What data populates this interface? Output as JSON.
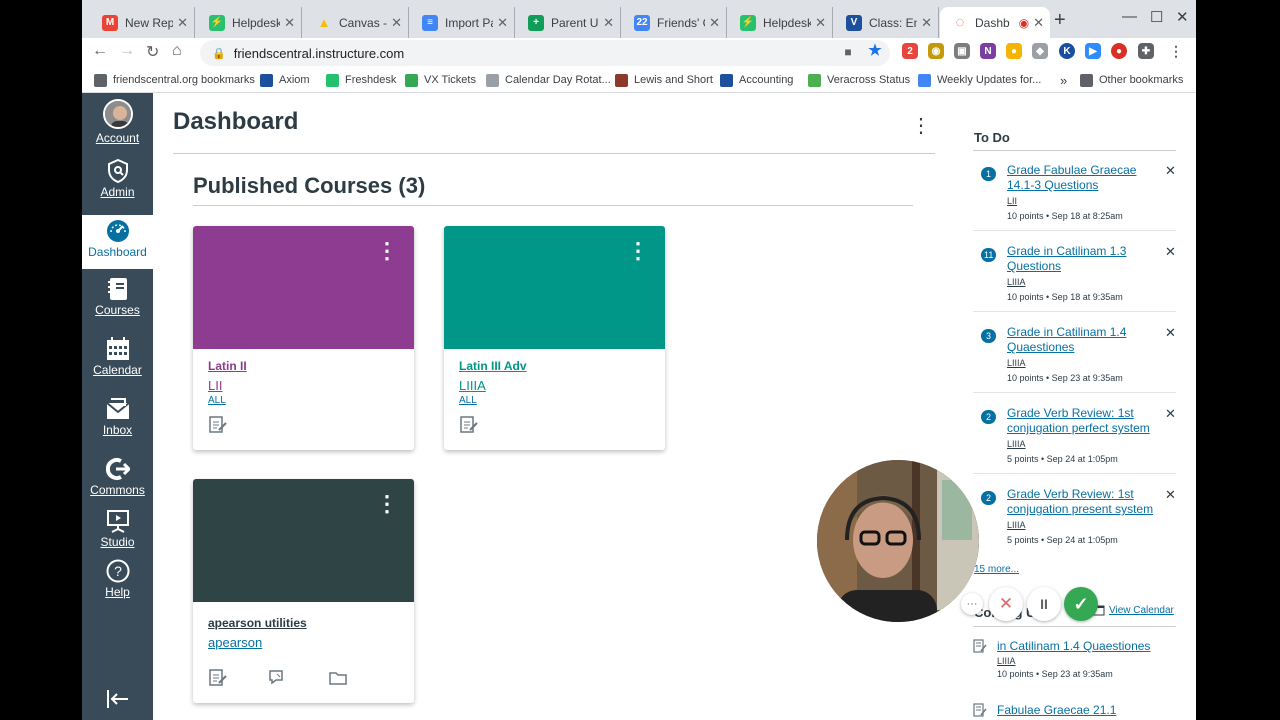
{
  "browser": {
    "tabs": [
      {
        "title": "New Reply",
        "icon": "gmail-icon",
        "color": "#ea4335",
        "glyph": "M"
      },
      {
        "title": "Helpdesk :",
        "icon": "freshdesk-icon",
        "color": "#25c16f",
        "glyph": "⚡"
      },
      {
        "title": "Canvas - G",
        "icon": "google-drive-icon",
        "color": "#fbbc04",
        "glyph": "▲"
      },
      {
        "title": "Import Par",
        "icon": "google-docs-icon",
        "color": "#4285f4",
        "glyph": "≡"
      },
      {
        "title": "Parent Use",
        "icon": "google-sheets-icon",
        "color": "#0f9d58",
        "glyph": "+"
      },
      {
        "title": "Friends' Ce",
        "icon": "google-calendar-icon",
        "color": "#4285f4",
        "glyph": "22"
      },
      {
        "title": "Helpdesk :",
        "icon": "freshdesk-icon",
        "color": "#25c16f",
        "glyph": "⚡"
      },
      {
        "title": "Class: Engl",
        "icon": "veracross-icon",
        "color": "#1c4f9c",
        "glyph": "V"
      },
      {
        "title": "Dashb",
        "icon": "canvas-icon",
        "color": "#e4572e",
        "glyph": "◌"
      }
    ],
    "url": "friendscentral.instructure.com",
    "bookmarks": [
      {
        "label": "friendscentral.org bookmarks",
        "icon": "folder-icon",
        "color": "#5f6368"
      },
      {
        "label": "Axiom",
        "icon": "veracross-icon",
        "color": "#1c4f9c"
      },
      {
        "label": "Freshdesk",
        "icon": "freshdesk-icon",
        "color": "#25c16f"
      },
      {
        "label": "VX Tickets",
        "icon": "vx-icon",
        "color": "#34a853"
      },
      {
        "label": "Calendar Day Rotat...",
        "icon": "globe-icon",
        "color": "#9aa0a6"
      },
      {
        "label": "Lewis and Short",
        "icon": "book-icon",
        "color": "#8b3a2b"
      },
      {
        "label": "Accounting",
        "icon": "veracross-icon",
        "color": "#1c4f9c"
      },
      {
        "label": "Veracross Status",
        "icon": "status-icon",
        "color": "#4caf50"
      },
      {
        "label": "Weekly Updates for...",
        "icon": "docs-icon",
        "color": "#4285f4"
      }
    ],
    "more_bookmarks": "»",
    "other_bookmarks": "Other bookmarks"
  },
  "global_nav": {
    "items": [
      {
        "label": "Account",
        "icon": "avatar-icon"
      },
      {
        "label": "Admin",
        "icon": "shield-icon"
      },
      {
        "label": "Dashboard",
        "icon": "dashboard-icon"
      },
      {
        "label": "Courses",
        "icon": "courses-icon"
      },
      {
        "label": "Calendar",
        "icon": "calendar-icon"
      },
      {
        "label": "Inbox",
        "icon": "inbox-icon"
      },
      {
        "label": "Commons",
        "icon": "commons-icon"
      },
      {
        "label": "Studio",
        "icon": "studio-icon"
      },
      {
        "label": "Help",
        "icon": "help-icon"
      }
    ],
    "collapse_icon": "collapse-nav-icon"
  },
  "dashboard": {
    "title": "Dashboard",
    "section_title": "Published Courses (3)",
    "cards": [
      {
        "name": "Latin II",
        "code": "LII",
        "term": "ALL",
        "color": "#8e3c91"
      },
      {
        "name": "Latin III Adv",
        "code": "LIIIA",
        "term": "ALL",
        "color": "#009688"
      },
      {
        "name": "apearson utilities",
        "code": "apearson",
        "term": "",
        "color": "#2f4545"
      }
    ]
  },
  "todo": {
    "heading": "To Do",
    "items": [
      {
        "count": "1",
        "title": "Grade Fabulae Graecae 14.1-3 Questions",
        "course": "LII",
        "meta": "10 points • Sep 18 at 8:25am"
      },
      {
        "count": "11",
        "title": "Grade in Catilinam 1.3 Questions",
        "course": "LIIIA",
        "meta": "10 points • Sep 18 at 9:35am"
      },
      {
        "count": "3",
        "title": "Grade in Catilinam 1.4 Quaestiones",
        "course": "LIIIA",
        "meta": "10 points • Sep 23 at 9:35am"
      },
      {
        "count": "2",
        "title": "Grade Verb Review: 1st conjugation perfect system",
        "course": "LIIIA",
        "meta": "5 points • Sep 24 at 1:05pm"
      },
      {
        "count": "2",
        "title": "Grade Verb Review: 1st conjugation present system",
        "course": "LIIIA",
        "meta": "5 points • Sep 24 at 1:05pm"
      }
    ],
    "more_link": "15 more...",
    "coming_up_heading": "Coming Up",
    "view_calendar": "View Calendar",
    "coming_up": [
      {
        "title": "in Catilinam 1.4 Quaestiones",
        "course": "LIIIA",
        "meta": "10 points • Sep 23 at 9:35am"
      },
      {
        "title": "Fabulae Graecae 21.1",
        "course": "",
        "meta": ""
      }
    ]
  },
  "recorder": {
    "more_glyph": "···",
    "cancel_glyph": "✕",
    "pause_glyph": "II",
    "done_glyph": "✓"
  }
}
